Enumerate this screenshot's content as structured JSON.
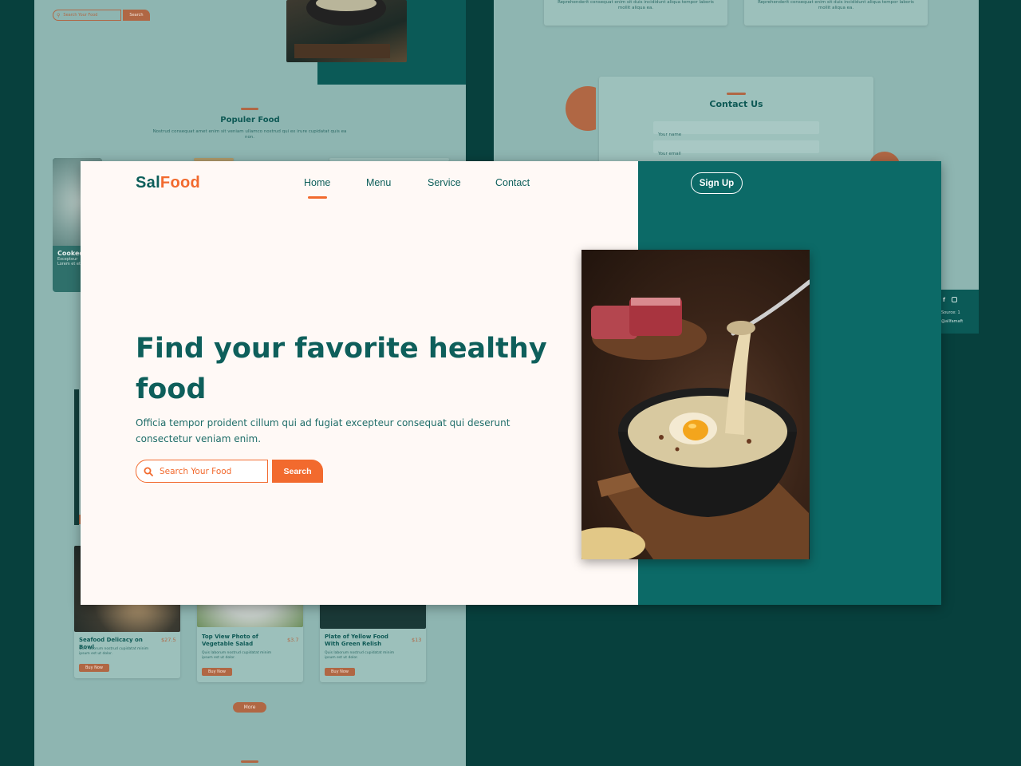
{
  "colors": {
    "brand_teal": "#0e5f5b",
    "accent_orange": "#f26a2e",
    "hero_right_bg": "#0c6a67",
    "page_bg": "#07403d"
  },
  "background_left": {
    "search_placeholder": "Search Your Food",
    "search_button": "Search",
    "section_title": "Populer Food",
    "section_desc": "Nostrud consequat amet enim sit veniam ullamco nostrud qui ex irure cupidatat quis ea non.",
    "card_title": "Cooked",
    "card_desc_1": "Excepteur",
    "card_desc_2": "Lorem et et",
    "menu_items": [
      {
        "title": "Seafood Delicacy on Bowl",
        "price": "$27.5",
        "desc": "Quis laborum nostrud cupidatat minim ipsum est ut dolor.",
        "button": "Buy Now"
      },
      {
        "title": "Top View Photo of Vegetable Salad",
        "price": "$3.7",
        "desc": "Quis laborum nostrud cupidatat minim ipsum est ut dolor.",
        "button": "Buy Now"
      },
      {
        "title": "Plate of Yellow Food With Green Relish",
        "price": "$13",
        "desc": "Quis laborum nostrud cupidatat minim ipsum est ut dolor.",
        "button": "Buy Now"
      }
    ],
    "more_button": "More"
  },
  "background_right": {
    "testimonial_1": "Reprehenderit consequat enim sit duis incididunt aliqua tempor laboris mollit aliqua ea.",
    "testimonial_2": "Reprehenderit consequat enim sit duis incididunt aliqua tempor laboris mollit aliqua ea.",
    "contact_title": "Contact Us",
    "name_placeholder": "Your name",
    "email_placeholder": "Your email",
    "footer_text_1": "Source: 1",
    "footer_text_2": "@allfamaft"
  },
  "header": {
    "logo_part1": "Sal",
    "logo_part2": "Food",
    "nav": [
      "Home",
      "Menu",
      "Service",
      "Contact"
    ],
    "active_nav": "Home",
    "signup": "Sign Up"
  },
  "hero": {
    "headline": "Find your favorite healthy food",
    "subtext": "Officia tempor proident cillum qui ad fugiat excepteur consequat qui deserunt consectetur veniam enim.",
    "search_placeholder": "Search Your Food",
    "search_button": "Search"
  },
  "icons": [
    "search-icon",
    "facebook-icon",
    "instagram-icon"
  ]
}
